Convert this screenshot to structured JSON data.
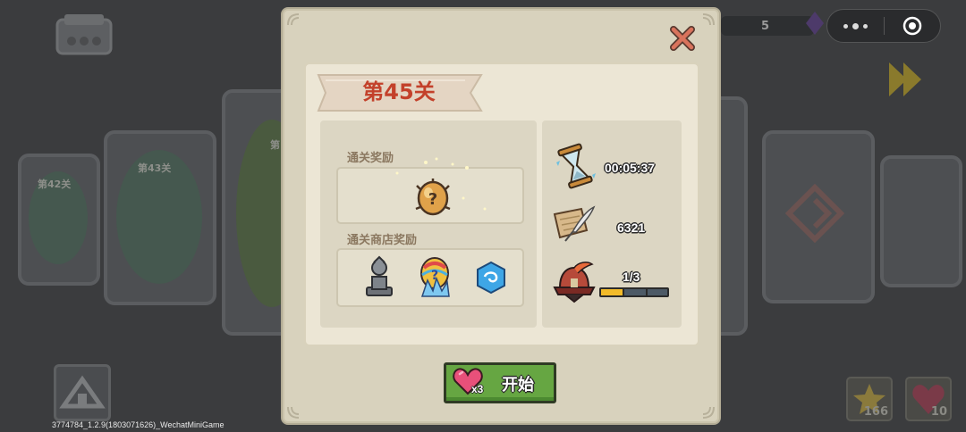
{
  "background": {
    "stage_cards": [
      "第42关",
      "第43关",
      "第"
    ],
    "top_counter": "5",
    "bottom_slots": [
      {
        "count": "166",
        "icon": "star-icon"
      },
      {
        "count": "10",
        "icon": "heart-icon"
      }
    ]
  },
  "version_text": "3774784_1.2.9(1803071626)_WechatMiniGame",
  "dialog": {
    "level_title": "第45关",
    "clear_rewards_label": "通关奖励",
    "clear_reward_item": "mystery-egg-icon",
    "shop_rewards_label": "通关商店奖励",
    "shop_reward_items": [
      "statue-icon",
      "rainbow-crystal-egg-icon",
      "blue-gem-icon"
    ],
    "stats": {
      "time_value": "00:05:37",
      "score_value": "6321",
      "progress_text": "1/3",
      "progress_fraction": 0.333
    },
    "start_button": {
      "label": "开始",
      "cost": "x3"
    }
  },
  "colors": {
    "title_red": "#c3412b",
    "start_green": "#66a642",
    "progress_yellow": "#f2bb2a"
  }
}
